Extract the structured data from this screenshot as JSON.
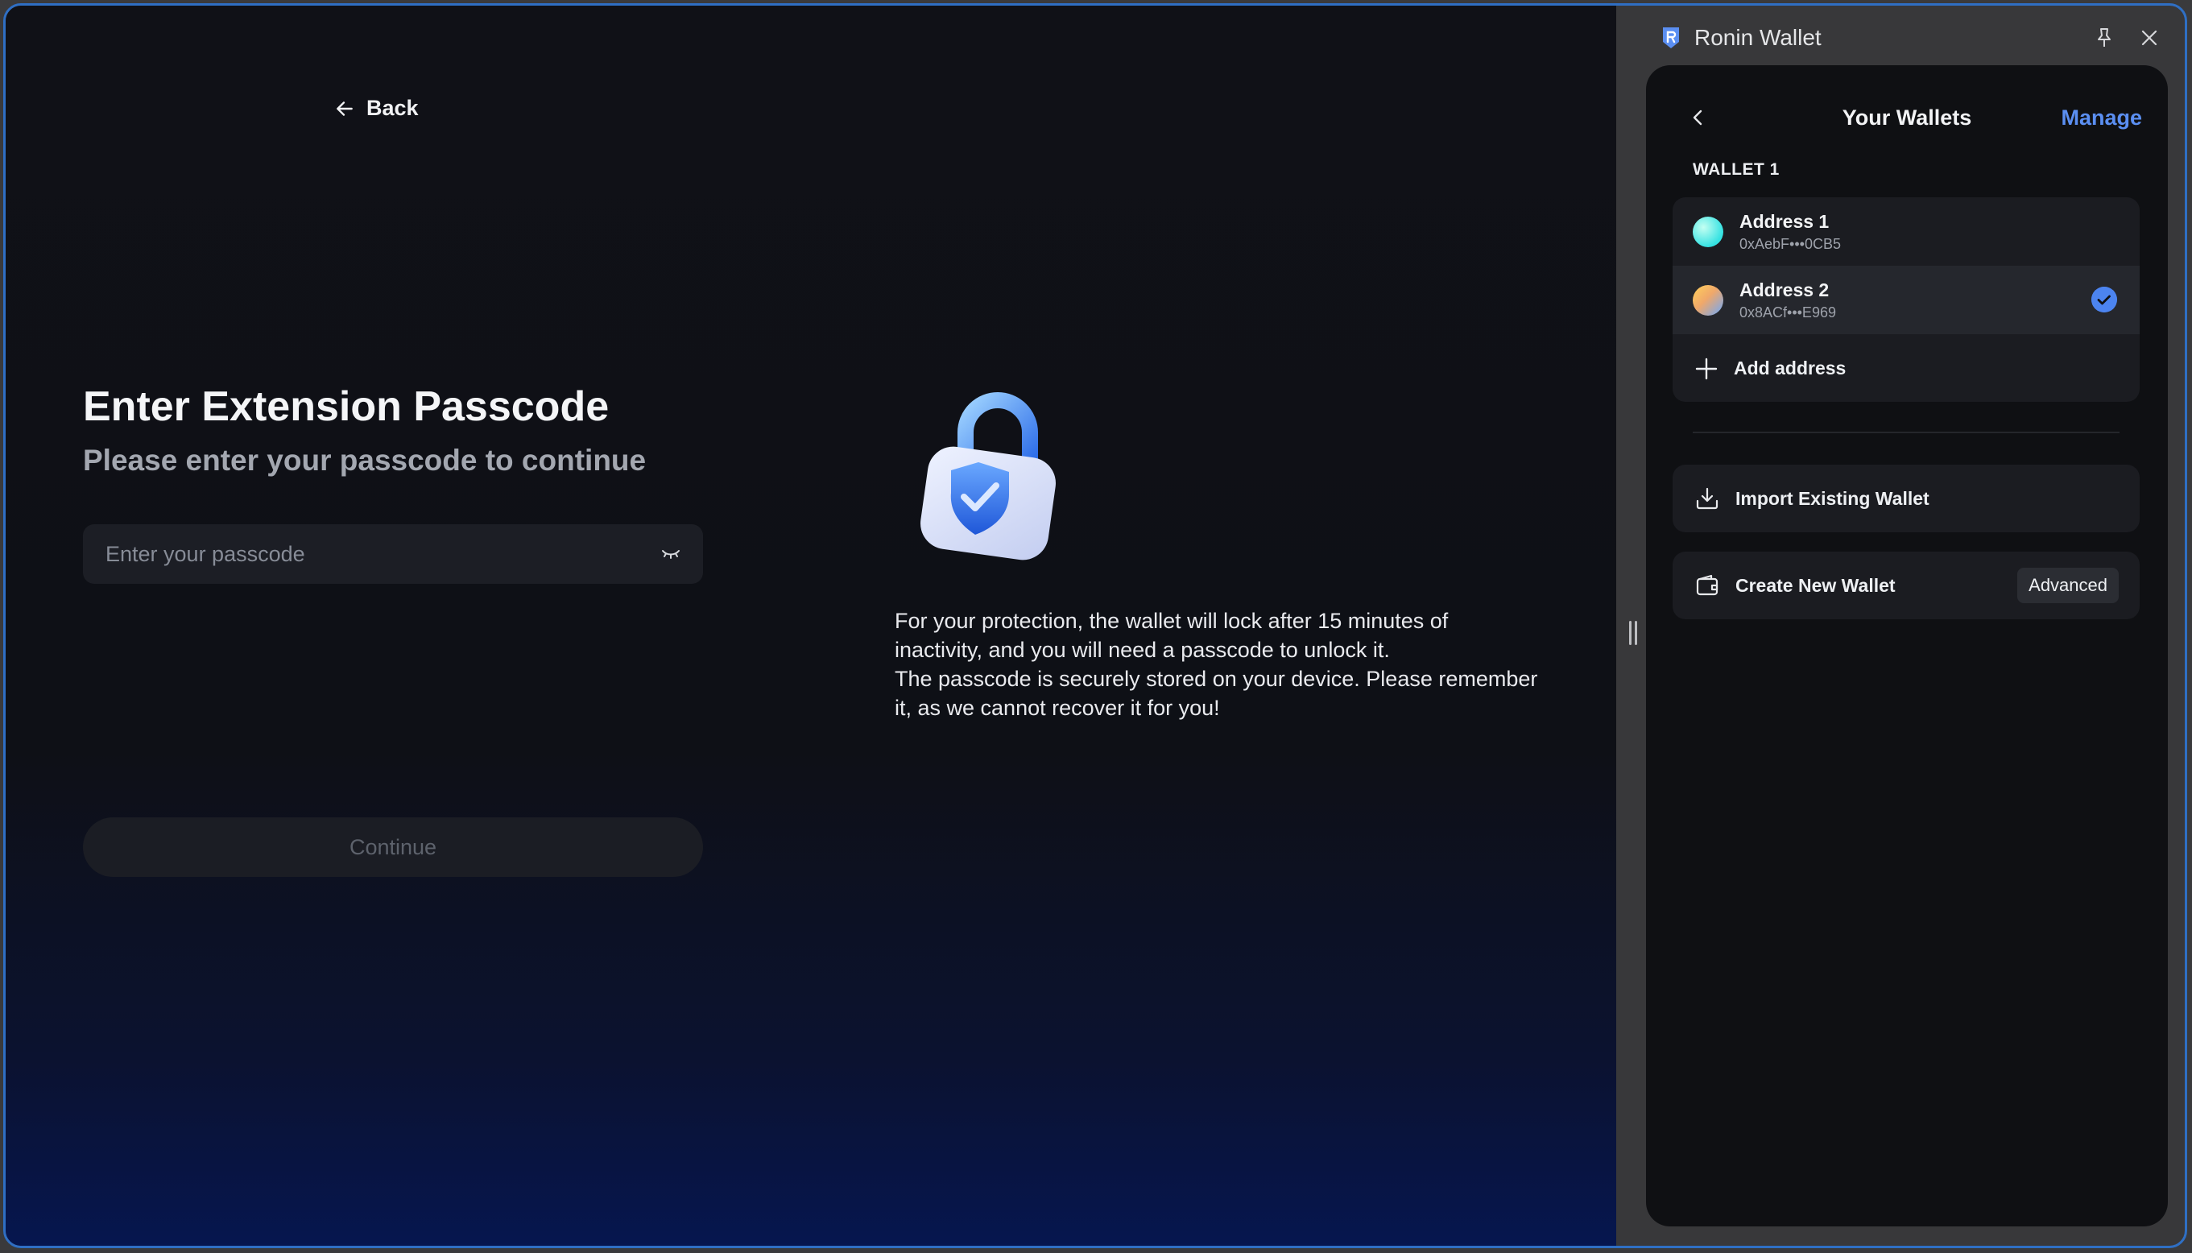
{
  "app": {
    "title": "Ronin Wallet"
  },
  "main": {
    "back_label": "Back",
    "title": "Enter Extension Passcode",
    "subtitle": "Please enter your passcode to continue",
    "passcode": {
      "placeholder": "Enter your passcode",
      "value": ""
    },
    "continue_label": "Continue",
    "info_lines": [
      "For your protection, the wallet will lock after 15 minutes of inactivity, and you will need a passcode to unlock it.",
      "The passcode is securely stored on your device. Please remember it, as we cannot recover it for you!"
    ]
  },
  "panel": {
    "title": "Your Wallets",
    "manage_label": "Manage",
    "wallet_label": "WALLET 1",
    "addresses": [
      {
        "name": "Address 1",
        "short": "0xAebF•••0CB5",
        "selected": false
      },
      {
        "name": "Address 2",
        "short": "0x8ACf•••E969",
        "selected": true
      }
    ],
    "add_address_label": "Add address",
    "import_label": "Import Existing Wallet",
    "create_label": "Create New Wallet",
    "advanced_label": "Advanced"
  },
  "colors": {
    "accent": "#5b8ff2",
    "check": "#4c84f0",
    "frame_border": "#2f6fc4"
  },
  "icons": [
    "arrow-left-icon",
    "eye-closed-icon",
    "lock-shield-icon",
    "ronin-logo-icon",
    "pin-icon",
    "close-icon",
    "chevron-left-icon",
    "checkmark-icon",
    "plus-icon",
    "download-icon",
    "wallet-icon"
  ]
}
